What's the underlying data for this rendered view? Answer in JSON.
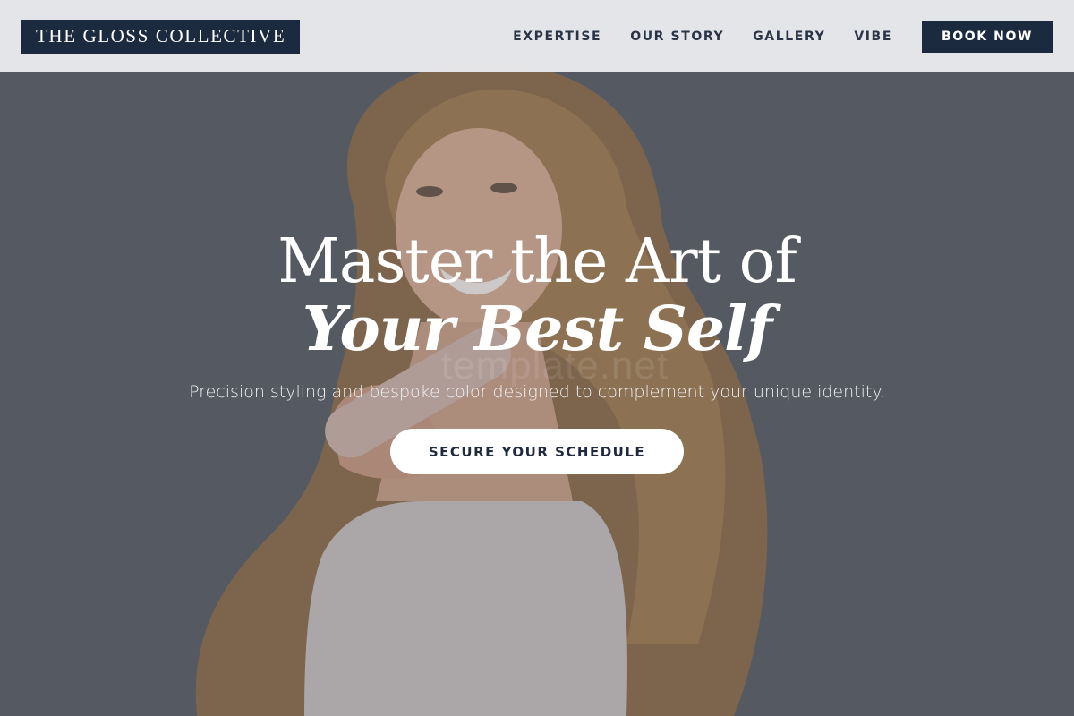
{
  "header": {
    "logo": "THE GLOSS COLLECTIVE",
    "nav": [
      "EXPERTISE",
      "OUR STORY",
      "GALLERY",
      "VIBE"
    ],
    "book_label": "BOOK NOW"
  },
  "hero": {
    "headline_line1": "Master the Art of",
    "headline_line2": "Your Best Self",
    "subtitle": "Precision styling and bespoke color designed to complement your unique identity.",
    "cta_label": "SECURE YOUR SCHEDULE",
    "watermark": "template.net"
  },
  "colors": {
    "brand_navy": "#1c2a40",
    "header_bg": "#e8e9ec",
    "cta_bg": "#ffffff"
  }
}
